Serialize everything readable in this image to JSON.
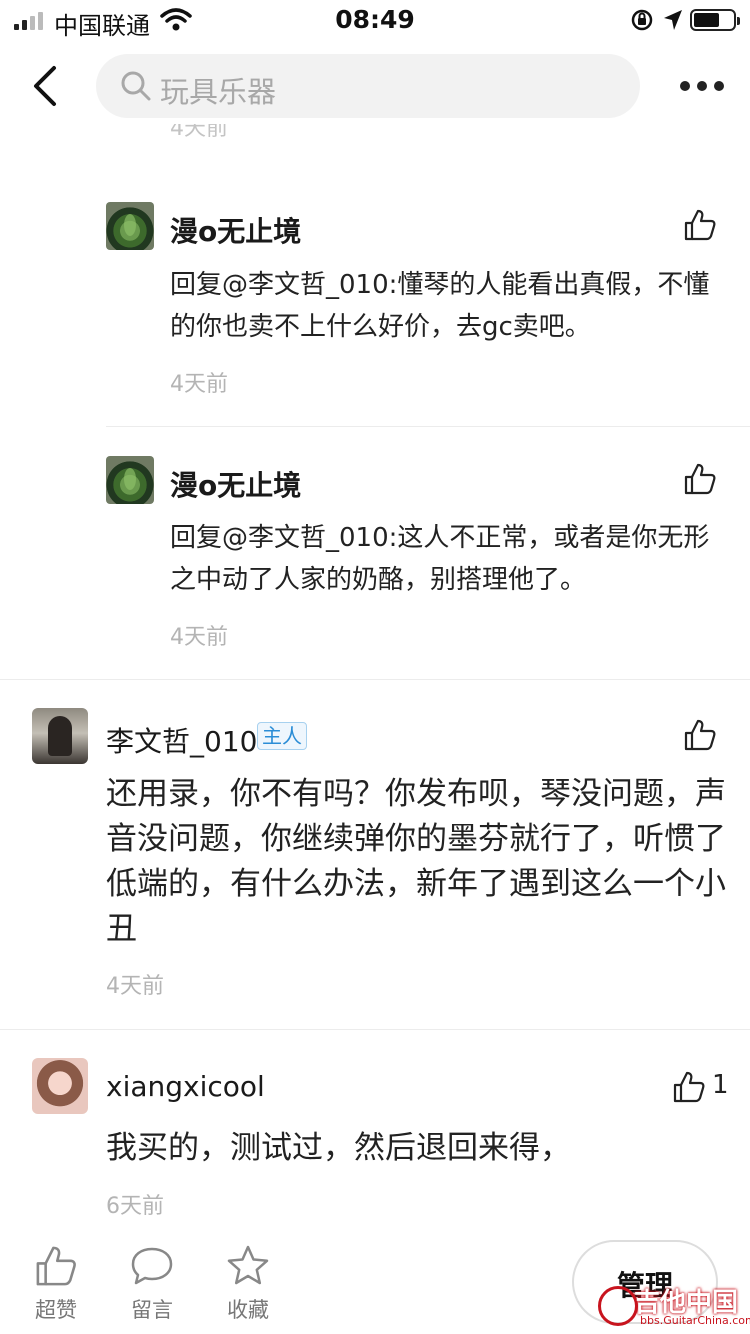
{
  "status_bar": {
    "carrier": "中国联通",
    "time": "08:49"
  },
  "nav": {
    "search_placeholder": "玩具乐器"
  },
  "clipped_time": "4天前",
  "replies": [
    {
      "user": "漫o无止境",
      "text": "回复@李文哲_010:懂琴的人能看出真假，不懂的你也卖不上什么好价，去gc卖吧。",
      "time": "4天前"
    },
    {
      "user": "漫o无止境",
      "text": "回复@李文哲_010:这人不正常，或者是你无形之中动了人家的奶酪，别搭理他了。",
      "time": "4天前"
    }
  ],
  "comments": [
    {
      "user": "李文哲_010",
      "tag": "主人",
      "text": "还用录，你不有吗？你发布呗，琴没问题，声音没问题，你继续弹你的墨芬就行了，听惯了低端的，有什么办法，新年了遇到这么一个小丑",
      "time": "4天前",
      "likes": ""
    },
    {
      "user": "xiangxicool",
      "tag": "",
      "text": "我买的，测试过，然后退回来得，",
      "time": "6天前",
      "likes": "1"
    }
  ],
  "bottom_bar": {
    "like_label": "超赞",
    "comment_label": "留言",
    "favorite_label": "收藏",
    "manage_label": "管理"
  },
  "watermark": {
    "text": "吉他中国",
    "url": "bbs.GuitarChina.com"
  }
}
